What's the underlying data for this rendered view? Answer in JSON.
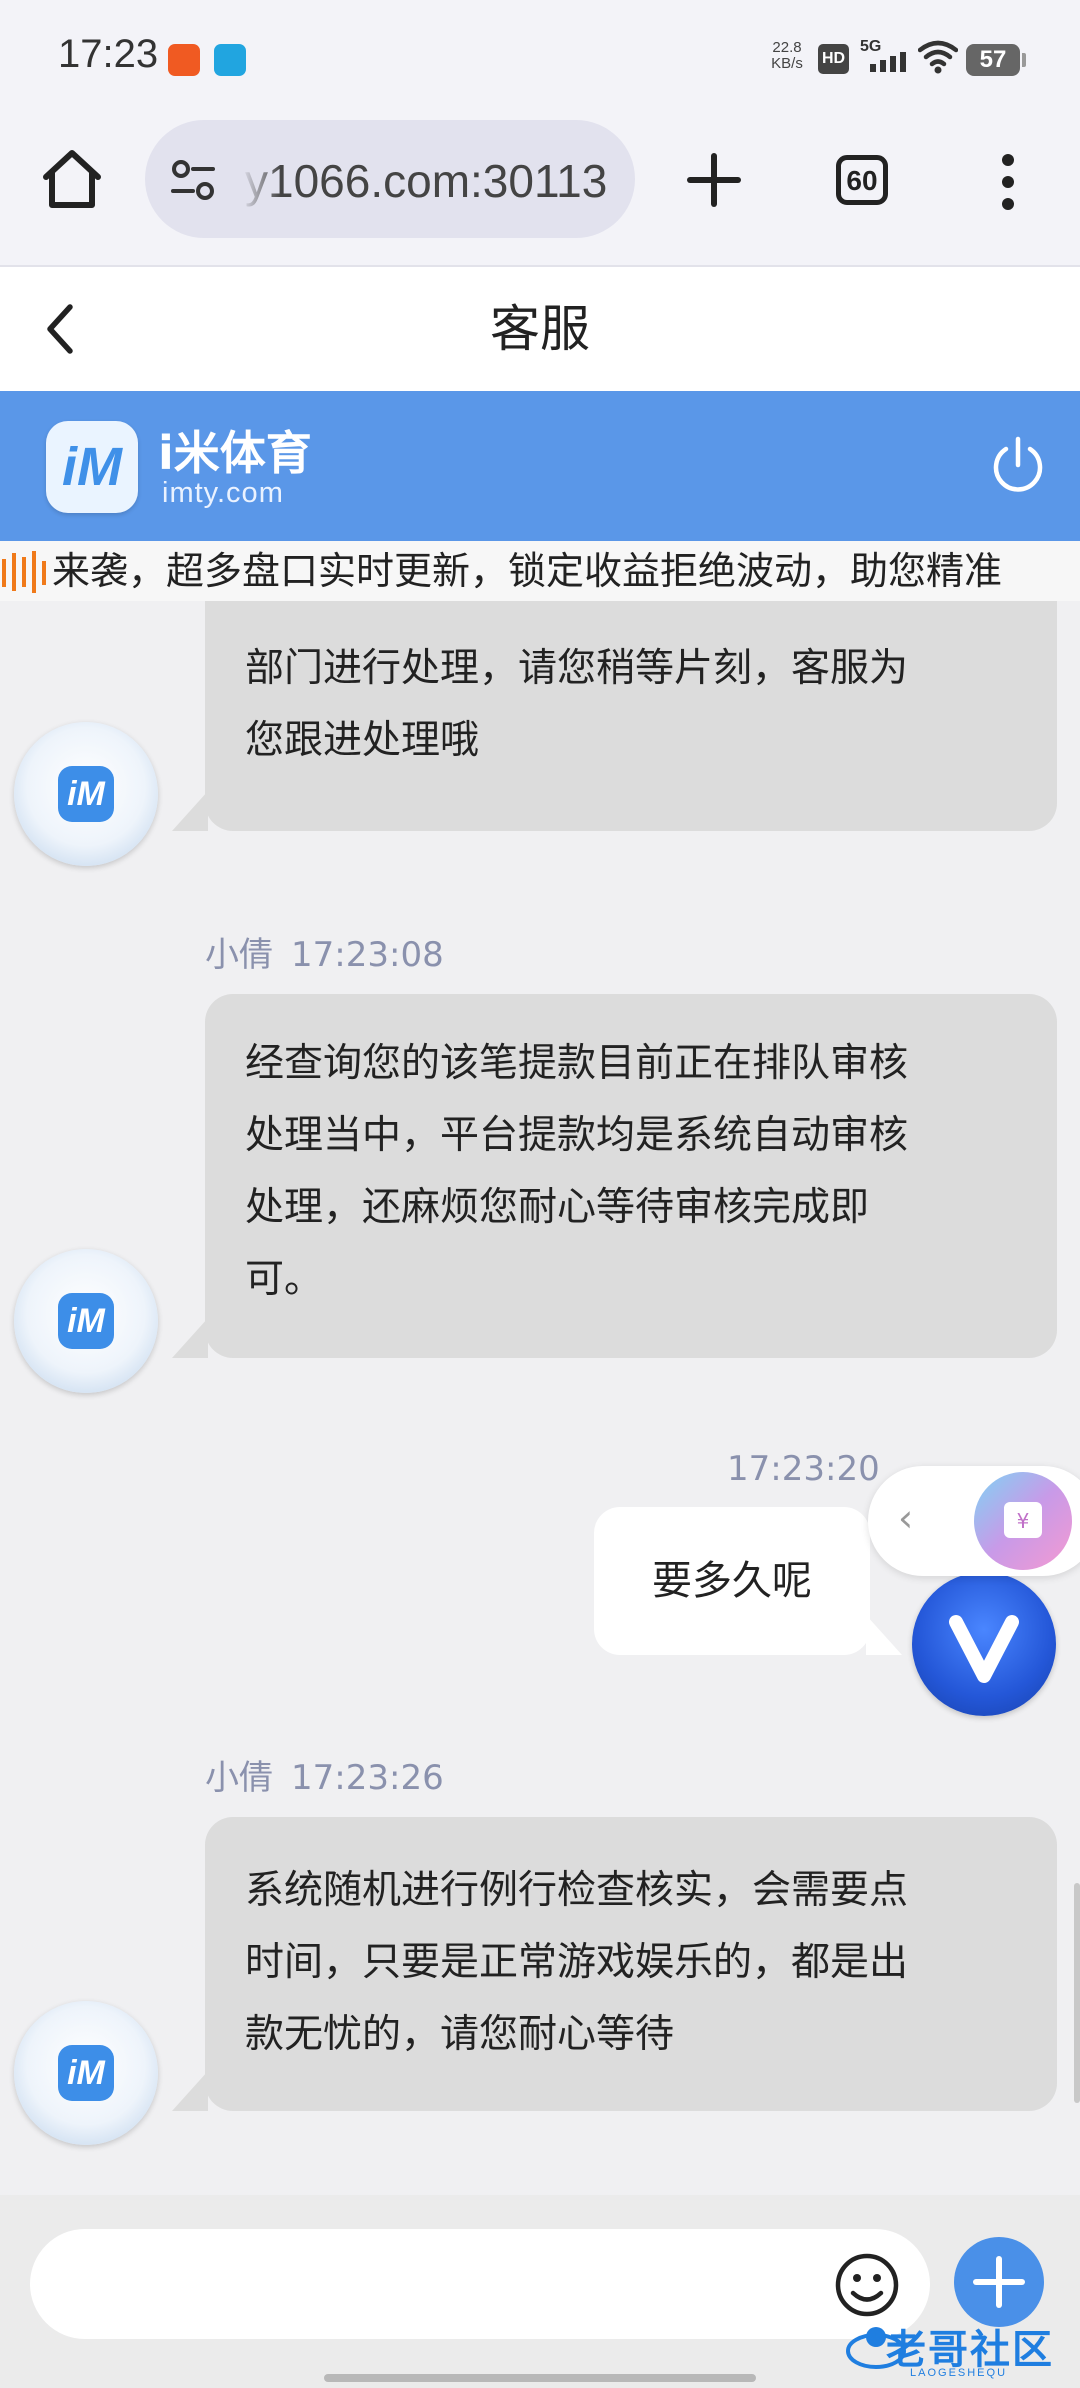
{
  "status_bar": {
    "time": "17:23",
    "net_speed_value": "22.8",
    "net_speed_unit": "KB/s",
    "hd_badge": "HD",
    "network": "5G",
    "battery": "57"
  },
  "browser": {
    "url": "y1066.com:30113",
    "tabs_count": "60"
  },
  "header": {
    "title": "客服"
  },
  "brand": {
    "name": "i米体育",
    "domain": "imty.com",
    "color": "#5a97e8"
  },
  "marquee": {
    "text": "来袭，超多盘口实时更新，锁定收益拒绝波动，助您精准"
  },
  "chat": {
    "messages": [
      {
        "from": "agent",
        "lines": [
          "部门进行处理，请您稍等片刻，客服为",
          "您跟进处理哦"
        ]
      },
      {
        "from": "agent",
        "sender": "小倩",
        "time": "17:23:08",
        "lines": [
          "经查询您的该笔提款目前正在排队审核",
          "处理当中，平台提款均是系统自动审核",
          "处理，还麻烦您耐心等待审核完成即",
          "可。"
        ]
      },
      {
        "from": "user",
        "time": "17:23:20",
        "text": "要多久呢"
      },
      {
        "from": "agent",
        "sender": "小倩",
        "time": "17:23:26",
        "lines": [
          "系统随机进行例行检查核实，会需要点",
          "时间，只要是正常游戏娱乐的，都是出",
          "款无忧的，请您耐心等待"
        ]
      }
    ]
  },
  "input": {
    "value": "",
    "placeholder": ""
  },
  "watermark": {
    "text": "老哥社区",
    "sub": "LAOGESHEQU"
  }
}
